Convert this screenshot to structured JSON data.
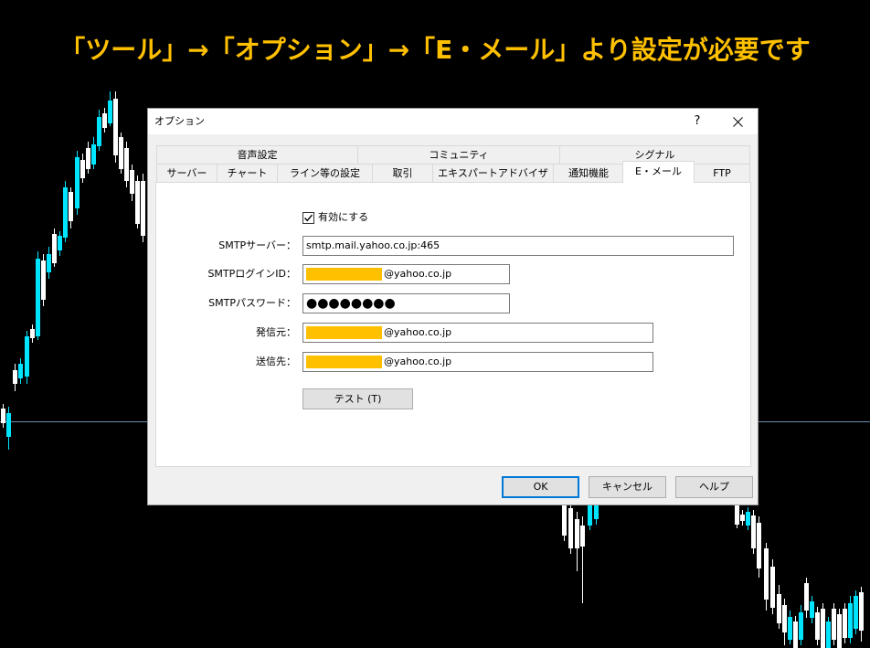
{
  "banner": {
    "text": "「ツール」→「オプション」→「E・メール」より設定が必要です"
  },
  "colors": {
    "background": "#000000",
    "banner": "#FFC000",
    "bull_candle": "#00E5FF",
    "bear_candle": "#FFFFFF",
    "price_line": "#6A8CB0",
    "redaction": "#FFC000",
    "default_button_border": "#0078D7"
  },
  "icons": {
    "close": "close-icon",
    "checkbox": "checkmark-icon"
  },
  "dialog": {
    "title": "オプション",
    "help_button": "?",
    "tabs_row1": [
      "音声設定",
      "コミュニティ",
      "シグナル"
    ],
    "tabs_row2": [
      "サーバー",
      "チャート",
      "ライン等の設定",
      "取引",
      "エキスパートアドバイザ",
      "通知機能",
      "E・メール",
      "FTP"
    ],
    "active_tab": "E・メール",
    "email": {
      "enabled": true,
      "enable_label": "有効にする",
      "smtp_server_label": "SMTPサーバー：",
      "smtp_server_value": "smtp.mail.yahoo.co.jp:465",
      "login_label": "SMTPログインID：",
      "login_value": "@yahoo.co.jp",
      "password_label": "SMTPパスワード：",
      "password_value": "●●●●●●●●",
      "from_label": "発信元：",
      "from_value": "@yahoo.co.jp",
      "to_label": "送信先：",
      "to_value": "@yahoo.co.jp",
      "test_button": "テスト (T)"
    },
    "buttons": {
      "ok": "OK",
      "cancel": "キャンセル",
      "help": "ヘルプ"
    }
  }
}
